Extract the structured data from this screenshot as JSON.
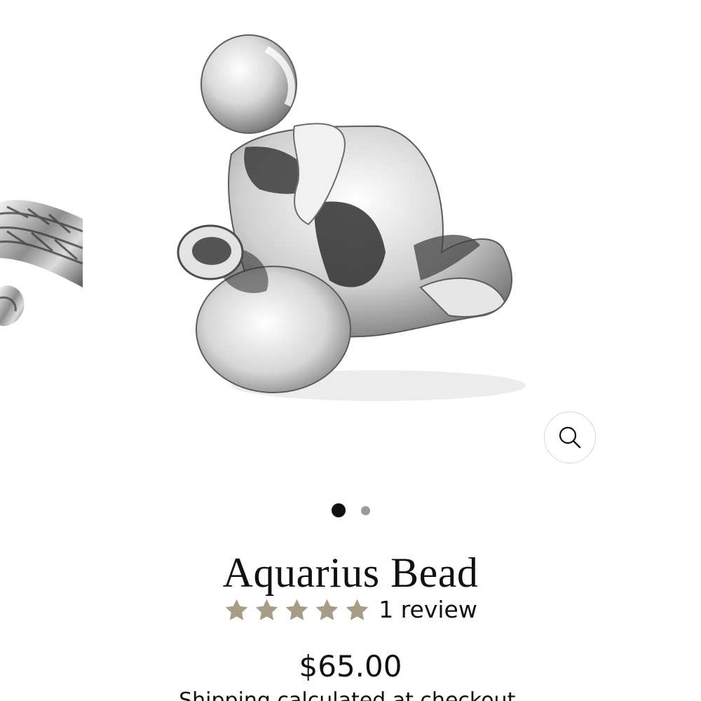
{
  "product": {
    "title": "Aquarius Bead",
    "rating": {
      "value": 5,
      "max": 5,
      "review_label": "1 review"
    },
    "price": "$65.00",
    "shipping_text": "Shipping ",
    "shipping_link": "calculated at checkout",
    "shipping_suffix": "."
  },
  "gallery": {
    "slide_count": 2,
    "active_slide": 1,
    "zoom_icon": "magnifier-icon"
  },
  "colors": {
    "star": "#a79d86",
    "text": "#111111",
    "dot_active": "#111111",
    "dot_inactive": "#9a9a9a"
  }
}
